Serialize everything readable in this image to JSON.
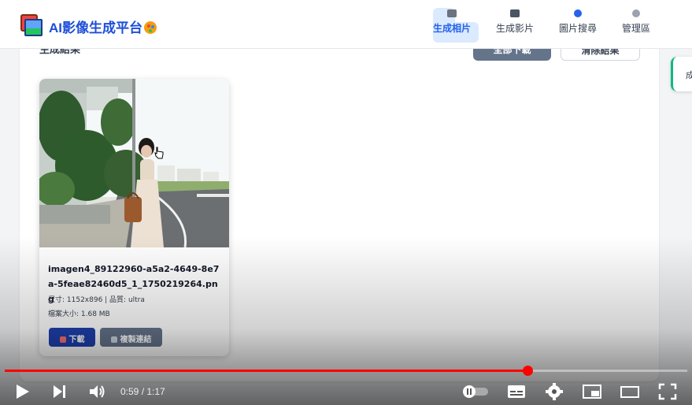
{
  "app": {
    "title": "AI影像生成平台"
  },
  "nav": [
    {
      "label": "生成相片",
      "icon": "camera-icon",
      "active": true,
      "color": "#6b7280"
    },
    {
      "label": "生成影片",
      "icon": "clapper-icon",
      "active": false,
      "color": "#4b5563"
    },
    {
      "label": "圖片搜尋",
      "icon": "magnifier-icon",
      "active": false,
      "color": "#2563eb"
    },
    {
      "label": "管理區",
      "icon": "gear-icon",
      "active": false,
      "color": "#9ca3af"
    }
  ],
  "results": {
    "section_title": "生成結果",
    "download_all_label": "全部下載",
    "clear_label": "清除結果",
    "side_tab_label": "成"
  },
  "card": {
    "file_name": "imagen4_89122960-a5a2-4649-8e7a-5feae82460d5_1_1750219264.png",
    "size_line": "尺寸: 1152x896 | 品質: ultra",
    "filesize_line": "檔案大小: 1.68 MB",
    "download_label": "下載",
    "copy_link_label": "複製連結"
  },
  "player": {
    "current_time": "0:59",
    "separator": " / ",
    "duration": "1:17",
    "progress": 0.7662,
    "accent_color": "#ff0000"
  }
}
